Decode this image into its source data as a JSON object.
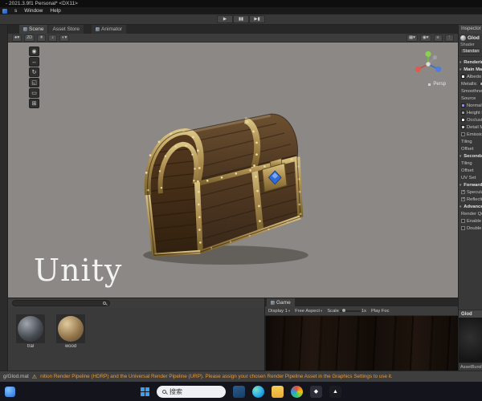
{
  "window": {
    "title": "- 2021.3.9f1 Personal* <DX11>"
  },
  "menubar": {
    "items": [
      "s",
      "Window",
      "Help"
    ]
  },
  "transport": {
    "play": "▶",
    "pause": "▮▮",
    "step": "▶▮"
  },
  "left_strip": {
    "icons": [
      {
        "name": "collapsed-hierarchy-icon",
        "glyph": "▤"
      },
      {
        "name": "collapsed-panel-icon",
        "glyph": "▥"
      }
    ]
  },
  "scene": {
    "tabs": {
      "scene": "Scene",
      "asset_store": "Asset Store",
      "animator": "Animator"
    },
    "toolbar": {
      "left": [
        {
          "name": "shading-mode-dropdown",
          "glyph": "●▾"
        },
        {
          "name": "2d-toggle",
          "glyph": "2D"
        },
        {
          "name": "lighting-toggle",
          "glyph": "☀"
        },
        {
          "name": "audio-toggle",
          "glyph": "♪"
        },
        {
          "name": "effects-dropdown",
          "glyph": "◐▾"
        }
      ],
      "right": [
        {
          "name": "grid-dropdown",
          "glyph": "▦▾"
        },
        {
          "name": "gizmos-dropdown",
          "glyph": "◉▾"
        },
        {
          "name": "camera-settings-icon",
          "glyph": "≡"
        },
        {
          "name": "overflow-menu-icon",
          "glyph": "⋮"
        }
      ]
    },
    "tools": [
      {
        "name": "hand-tool",
        "glyph": "◉"
      },
      {
        "name": "move-tool",
        "glyph": "↔"
      },
      {
        "name": "rotate-tool",
        "glyph": "↻"
      },
      {
        "name": "scale-tool",
        "glyph": "◱"
      },
      {
        "name": "rect-tool",
        "glyph": "▭"
      },
      {
        "name": "transform-tool",
        "glyph": "⊞"
      }
    ],
    "watermark": "Unity",
    "gizmo_label": "Persp"
  },
  "inspector": {
    "tab": "Inspector",
    "material_name": "Glod",
    "shader_label": "Shader",
    "shader_value": "Standard",
    "rows": [
      {
        "kind": "section",
        "label": "Rendering Mode"
      },
      {
        "kind": "section",
        "label": "Main Maps"
      },
      {
        "kind": "map",
        "label": "Albedo",
        "swatch": "#ffffff"
      },
      {
        "kind": "slider",
        "label": "Metallic"
      },
      {
        "kind": "slider",
        "label": "Smoothness"
      },
      {
        "kind": "row",
        "label": "Source"
      },
      {
        "kind": "map",
        "label": "Normal Map",
        "swatch": "#8d8dff"
      },
      {
        "kind": "map",
        "label": "Height Map",
        "swatch": "#9a9a9a"
      },
      {
        "kind": "map",
        "label": "Occlusion",
        "swatch": "#ffffff"
      },
      {
        "kind": "map",
        "label": "Detail Mask",
        "swatch": "#cccccc"
      },
      {
        "kind": "check",
        "label": "Emission"
      },
      {
        "kind": "row",
        "label": "Tiling"
      },
      {
        "kind": "row",
        "label": "Offset"
      },
      {
        "kind": "section",
        "label": "Secondary Maps"
      },
      {
        "kind": "row",
        "label": "Tiling"
      },
      {
        "kind": "row",
        "label": "Offset"
      },
      {
        "kind": "row",
        "label": "UV Set"
      },
      {
        "kind": "section",
        "label": "Forward Rendering Options"
      },
      {
        "kind": "checkon",
        "label": "Specular Highlights"
      },
      {
        "kind": "checkon",
        "label": "Reflections"
      },
      {
        "kind": "section",
        "label": "Advanced Options"
      },
      {
        "kind": "row",
        "label": "Render Queue"
      },
      {
        "kind": "check",
        "label": "Enable GPU Instancing"
      },
      {
        "kind": "check",
        "label": "Double Sided Global Illumination"
      }
    ],
    "preview_header": "Glod",
    "assetbundle_label": "AssetBundle"
  },
  "project": {
    "toolbar_icons": [
      {
        "name": "favorites-icon",
        "glyph": "★"
      },
      {
        "name": "layout-icon",
        "glyph": "▦"
      },
      {
        "name": "panel-menu-icon",
        "glyph": "⋮"
      }
    ],
    "items": [
      {
        "kind": "metal",
        "label": "tral"
      },
      {
        "kind": "wood",
        "label": "wood"
      }
    ]
  },
  "game": {
    "tab": "Game",
    "display": "Display 1",
    "aspect": "Free Aspect",
    "scale_label": "Scale",
    "scale_value": "1x",
    "play_focused": "Play Foc"
  },
  "statusbar": {
    "path": "g/Glod.mat",
    "warning_icon": "⚠",
    "warning": "nition Render Pipeline (HDRP) and the Universal Render Pipeline (URP). Please assign your chosen Render Pipeline Asset in the Graphics Settings to use it."
  },
  "taskbar": {
    "search_placeholder": "搜索",
    "apps": [
      {
        "name": "store-icon",
        "kind": "bag",
        "glyph": ""
      },
      {
        "name": "edge-icon",
        "kind": "edge",
        "glyph": ""
      },
      {
        "name": "file-explorer-icon",
        "kind": "folder",
        "glyph": ""
      },
      {
        "name": "photos-icon",
        "kind": "photos",
        "glyph": ""
      },
      {
        "name": "unity-hub-icon",
        "kind": "unityhub",
        "glyph": "◆"
      },
      {
        "name": "unity-editor-icon",
        "kind": "unity",
        "glyph": "▲"
      }
    ]
  },
  "colors": {
    "scene_background": "#8b8885",
    "warning_text": "#e89a3c",
    "gem_accent": "#2f6bd6",
    "taskbar_background": "#14141d"
  }
}
